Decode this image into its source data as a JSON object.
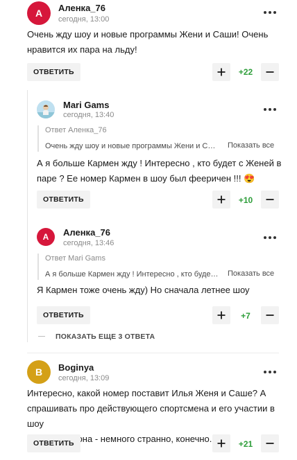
{
  "ui": {
    "reply_label": "ОТВЕТИТЬ",
    "show_all_label": "Показать все",
    "show_more_replies": "ПОКАЗАТЬ ЕЩЕ 3 ОТВЕТА",
    "accent_red": "#d6173b",
    "accent_gold": "#d4a017",
    "score_color": "#2e9e3a"
  },
  "comments": [
    {
      "avatar_letter": "А",
      "author": "Аленка_76",
      "time": "сегодня, 13:00",
      "text_lines": [
        "Очень жду шоу и новые программы Жени и Саши! Очень",
        "нравится их пара на льду!"
      ],
      "score": "+22"
    },
    {
      "avatar_icon": "user-photo",
      "author": "Mari Gams",
      "time": "сегодня, 13:40",
      "quote_author": "Ответ Аленка_76",
      "quote_text": "Очень жду шоу и новые программы Жени и С…",
      "text_lines": [
        "А я больше Кармен жду ! Интересно , кто будет с Женей в",
        "паре ? Ее номер Кармен в шоу был фееричен !!! 😍"
      ],
      "score": "+10"
    },
    {
      "avatar_letter": "А",
      "author": "Аленка_76",
      "time": "сегодня, 13:46",
      "quote_author": "Ответ Mari Gams",
      "quote_text": "А я больше Кармен жду ! Интересно , кто буде…",
      "text_lines": [
        "Я Кармен тоже очень жду) Но сначала летнее шоу"
      ],
      "score": "+7"
    },
    {
      "avatar_letter": "B",
      "author": "Boginya",
      "time": "сегодня, 13:09",
      "text_lines": [
        "Интересно, какой номер поставит Илья Женя и Саше? А",
        "спрашивать про действующего спортсмена и его участии в шоу",
        "в разгар сезона - немного странно, конечно."
      ],
      "score": "+21"
    }
  ]
}
